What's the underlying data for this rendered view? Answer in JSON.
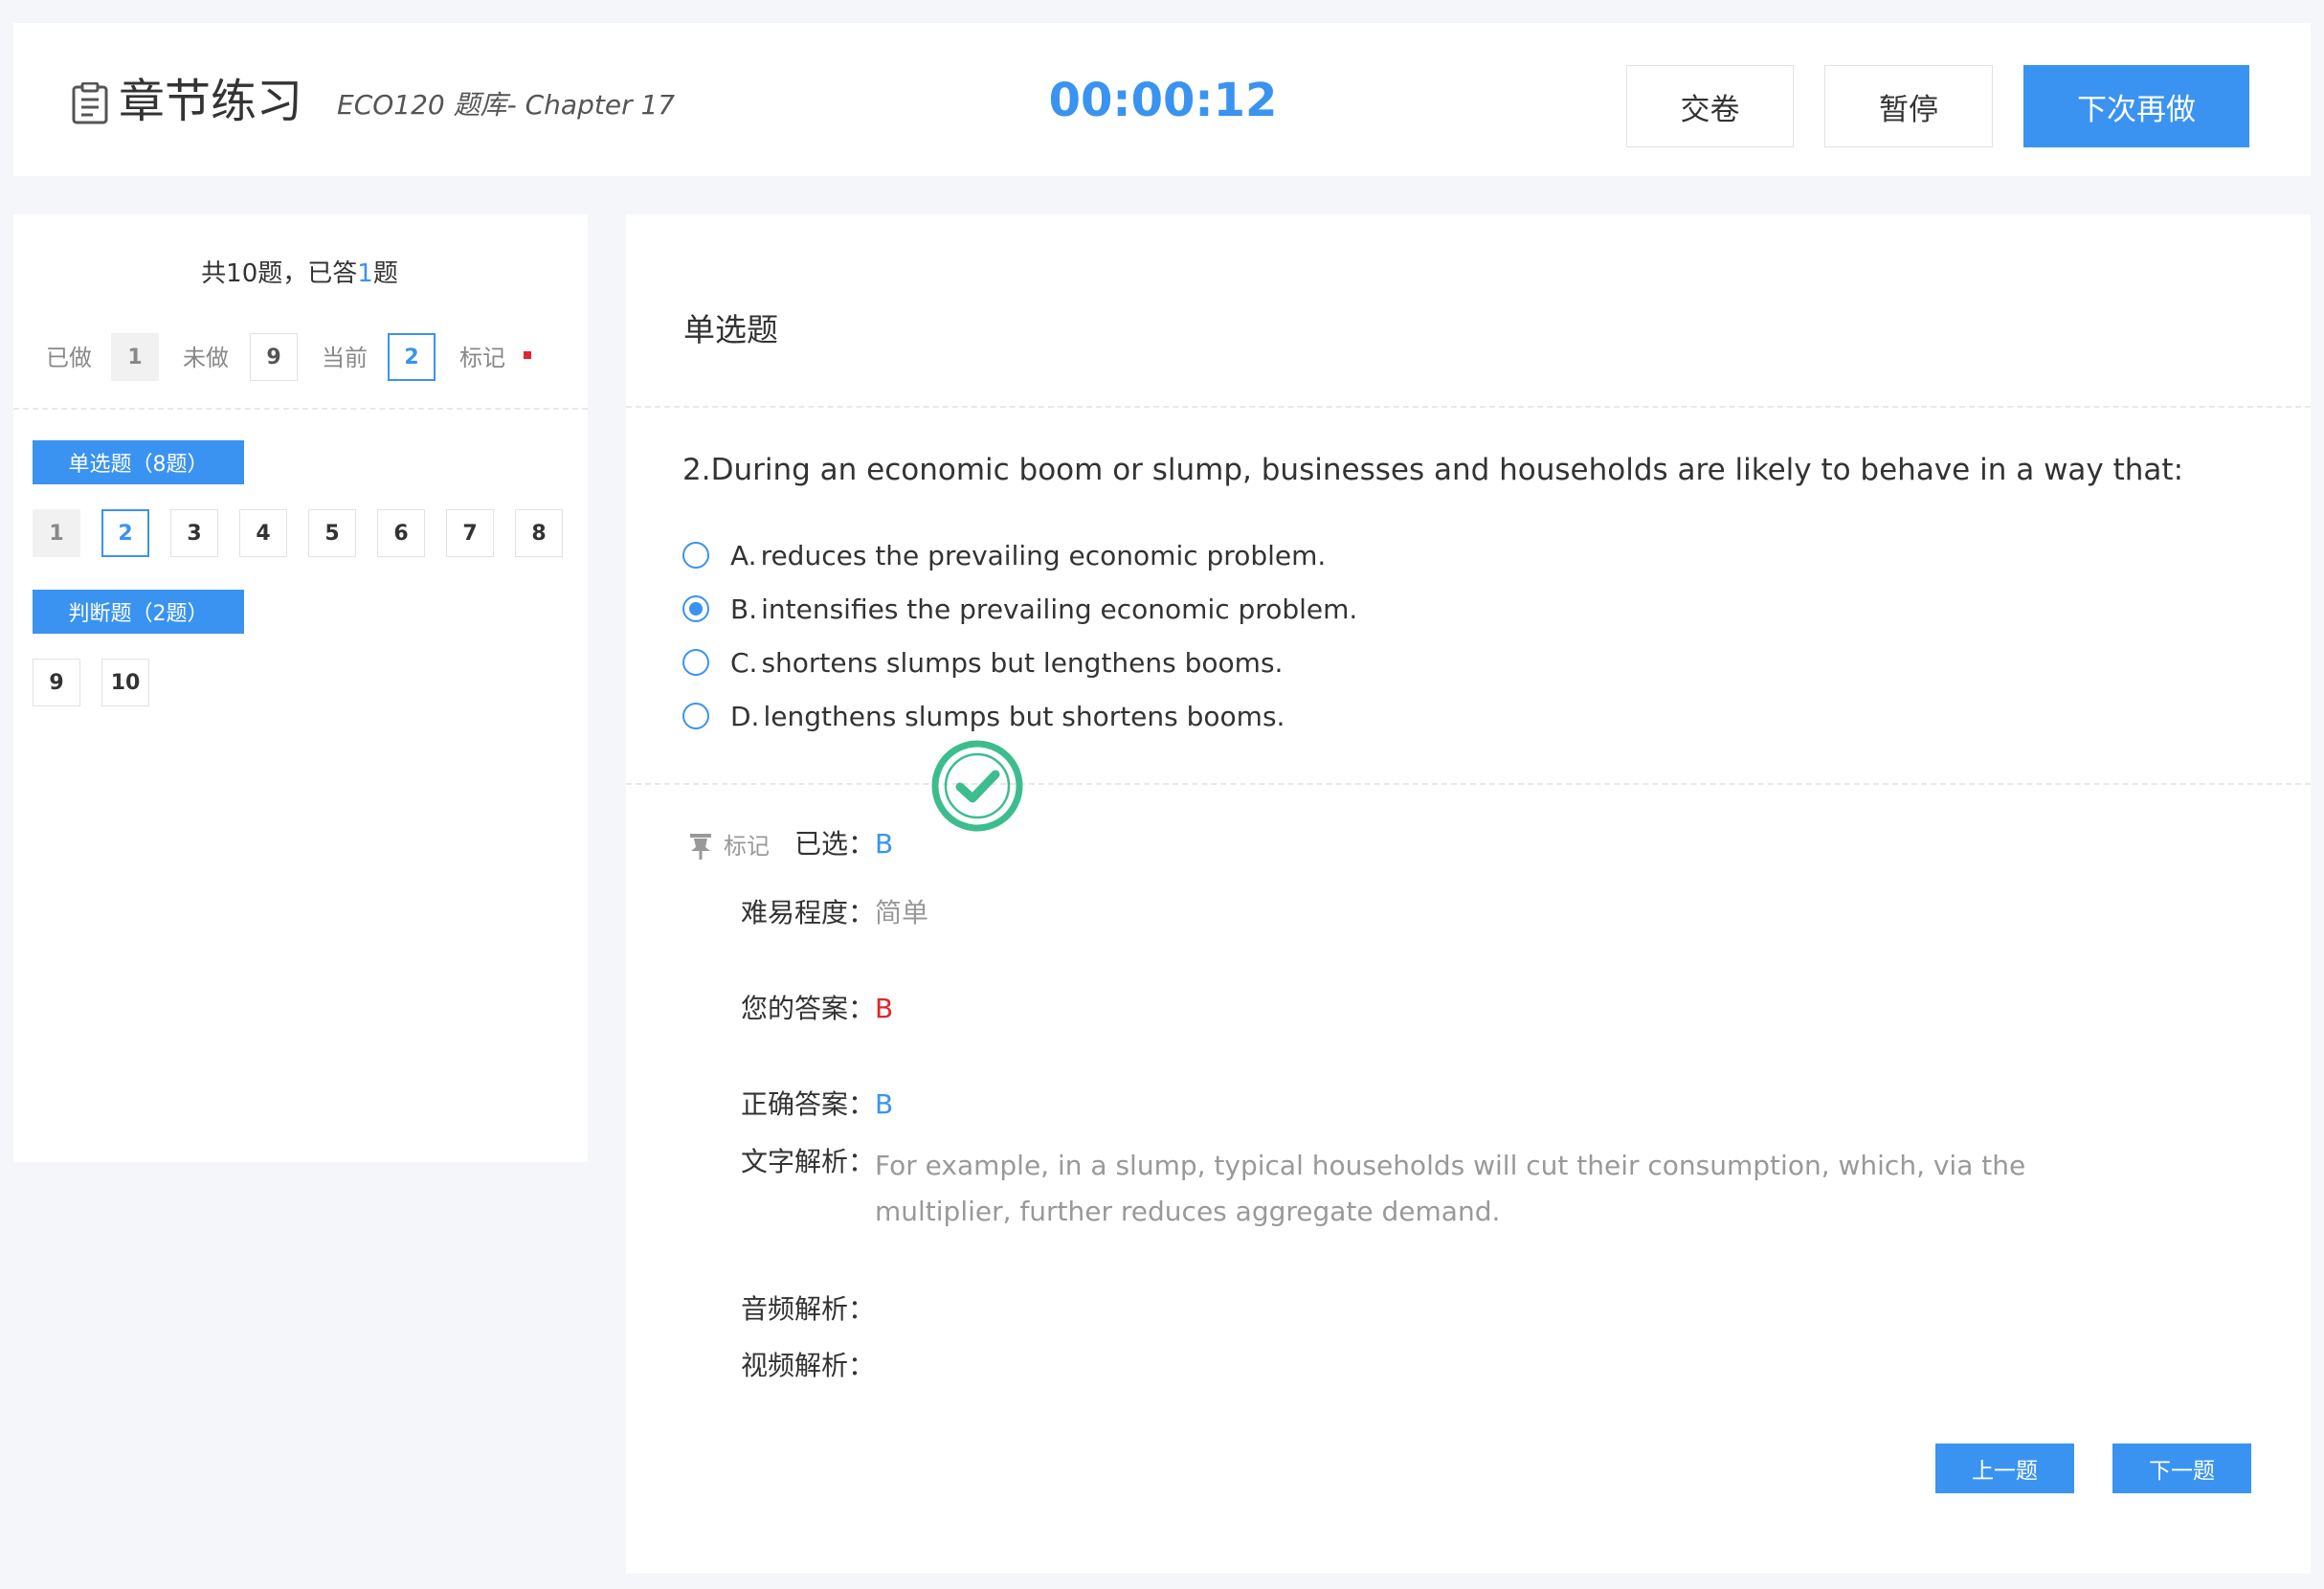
{
  "header": {
    "title": "章节练习",
    "bank": "ECO120 题库- Chapter 17",
    "timer": "00:00:12",
    "buttons": {
      "submit": "交卷",
      "pause": "暂停",
      "later": "下次再做"
    }
  },
  "sidebar": {
    "summary": {
      "prefix": "共10题，已答",
      "answered": "1",
      "suffix": "题"
    },
    "legend": {
      "done_label": "已做",
      "done_count": "1",
      "todo_label": "未做",
      "todo_count": "9",
      "current_label": "当前",
      "current_num": "2",
      "mark_label": "标记"
    },
    "sections": [
      {
        "title": "单选题（8题）",
        "questions": [
          "1",
          "2",
          "3",
          "4",
          "5",
          "6",
          "7",
          "8"
        ]
      },
      {
        "title": "判断题（2题）",
        "questions": [
          "9",
          "10"
        ]
      }
    ]
  },
  "question": {
    "type": "单选题",
    "text": "2.During an economic boom or slump, businesses and households are likely to behave in a way that:",
    "options": [
      {
        "letter": "A.",
        "text": "reduces the prevailing economic problem.",
        "selected": false
      },
      {
        "letter": "B.",
        "text": "intensifies the prevailing economic problem.",
        "selected": true
      },
      {
        "letter": "C.",
        "text": "shortens slumps but lengthens booms.",
        "selected": false
      },
      {
        "letter": "D.",
        "text": "lengthens slumps but shortens booms.",
        "selected": false
      }
    ]
  },
  "result": {
    "mark_label": "标记",
    "selected_label": "已选：",
    "selected_value": "B",
    "difficulty_label": "难易程度：",
    "difficulty_value": "简单",
    "your_answer_label": "您的答案：",
    "your_answer_value": "B",
    "correct_answer_label": "正确答案：",
    "correct_answer_value": "B",
    "explanation_label": "文字解析：",
    "explanation_text": "For example, in a slump, typical households will cut their consumption, which, via the multiplier, further reduces aggregate demand.",
    "audio_label": "音频解析：",
    "video_label": "视频解析："
  },
  "nav": {
    "prev": "上一题",
    "next": "下一题"
  },
  "colors": {
    "accent": "#3a93f0",
    "wrong": "#e0262d",
    "correct_stamp": "#3dbd8e"
  }
}
